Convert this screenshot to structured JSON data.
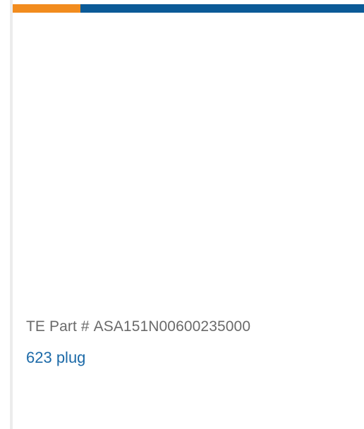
{
  "colors": {
    "accent_orange": "#f28c1e",
    "accent_blue": "#0b5a97",
    "part_text": "#6a6a6a",
    "link": "#1c6aa8"
  },
  "product": {
    "part_label": "TE Part #",
    "part_number": "ASA151N00600235000",
    "name": "623 plug"
  }
}
